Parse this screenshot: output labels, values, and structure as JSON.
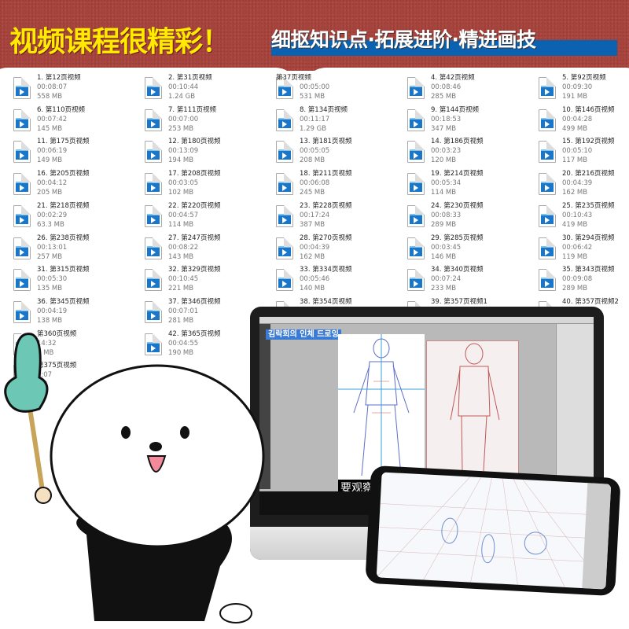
{
  "banner": {
    "title": "视频课程很精彩！",
    "subtitle": "细抠知识点·拓展进阶·精进画技",
    "colors": {
      "background": "#a8433c",
      "title": "#ffea00",
      "subtitle_bar": "#0b62b0"
    }
  },
  "files": [
    {
      "name": "1. 第12页视频",
      "duration": "00:08:07",
      "size": "558 MB"
    },
    {
      "name": "2. 第31页视频",
      "duration": "00:10:44",
      "size": "1.24 GB"
    },
    {
      "name": "第37页视频",
      "duration": "00:05:00",
      "size": "531 MB"
    },
    {
      "name": "4. 第42页视频",
      "duration": "00:08:46",
      "size": "285 MB"
    },
    {
      "name": "5. 第92页视频",
      "duration": "00:09:30",
      "size": "191 MB"
    },
    {
      "name": "6. 第110页视频",
      "duration": "00:07:42",
      "size": "145 MB"
    },
    {
      "name": "7. 第111页视频",
      "duration": "00:07:00",
      "size": "253 MB"
    },
    {
      "name": "8. 第134页视频",
      "duration": "00:11:17",
      "size": "1.29 GB"
    },
    {
      "name": "9. 第144页视频",
      "duration": "00:18:53",
      "size": "347 MB"
    },
    {
      "name": "10. 第146页视频",
      "duration": "00:04:28",
      "size": "499 MB"
    },
    {
      "name": "11. 第175页视频",
      "duration": "00:06:19",
      "size": "149 MB"
    },
    {
      "name": "12. 第180页视频",
      "duration": "00:13:09",
      "size": "194 MB"
    },
    {
      "name": "13. 第181页视频",
      "duration": "00:05:05",
      "size": "208 MB"
    },
    {
      "name": "14. 第186页视频",
      "duration": "00:03:23",
      "size": "120 MB"
    },
    {
      "name": "15. 第192页视频",
      "duration": "00:05:10",
      "size": "117 MB"
    },
    {
      "name": "16. 第205页视频",
      "duration": "00:04:12",
      "size": "205 MB"
    },
    {
      "name": "17. 第208页视频",
      "duration": "00:03:05",
      "size": "102 MB"
    },
    {
      "name": "18. 第211页视频",
      "duration": "00:06:08",
      "size": "245 MB"
    },
    {
      "name": "19. 第214页视频",
      "duration": "00:05:34",
      "size": "114 MB"
    },
    {
      "name": "20. 第216页视频",
      "duration": "00:04:39",
      "size": "162 MB"
    },
    {
      "name": "21. 第218页视频",
      "duration": "00:02:29",
      "size": "63.3 MB"
    },
    {
      "name": "22. 第220页视频",
      "duration": "00:04:57",
      "size": "114 MB"
    },
    {
      "name": "23. 第228页视频",
      "duration": "00:17:24",
      "size": "387 MB"
    },
    {
      "name": "24. 第230页视频",
      "duration": "00:08:33",
      "size": "289 MB"
    },
    {
      "name": "25. 第235页视频",
      "duration": "00:10:43",
      "size": "419 MB"
    },
    {
      "name": "26. 第238页视频",
      "duration": "00:13:01",
      "size": "257 MB"
    },
    {
      "name": "27. 第247页视频",
      "duration": "00:08:22",
      "size": "143 MB"
    },
    {
      "name": "28. 第270页视频",
      "duration": "00:04:39",
      "size": "162 MB"
    },
    {
      "name": "29. 第285页视频",
      "duration": "00:03:45",
      "size": "146 MB"
    },
    {
      "name": "30. 第294页视频",
      "duration": "00:06:42",
      "size": "119 MB"
    },
    {
      "name": "31. 第315页视频",
      "duration": "00:05:30",
      "size": "135 MB"
    },
    {
      "name": "32. 第329页视频",
      "duration": "00:10:45",
      "size": "221 MB"
    },
    {
      "name": "33. 第334页视频",
      "duration": "00:05:46",
      "size": "140 MB"
    },
    {
      "name": "34. 第340页视频",
      "duration": "00:07:24",
      "size": "233 MB"
    },
    {
      "name": "35. 第343页视频",
      "duration": "00:09:08",
      "size": "289 MB"
    },
    {
      "name": "36. 第345页视频",
      "duration": "00:04:19",
      "size": "138 MB"
    },
    {
      "name": "37. 第346页视频",
      "duration": "00:07:01",
      "size": "281 MB"
    },
    {
      "name": "38. 第354页视频",
      "duration": "",
      "size": ""
    },
    {
      "name": "39. 第357页视频1",
      "duration": "",
      "size": ""
    },
    {
      "name": "40. 第357页视频2",
      "duration": "",
      "size": ""
    },
    {
      "name": "第360页视频",
      "duration": "14:32",
      "size": "8 MB"
    },
    {
      "name": "42. 第365页视频",
      "duration": "00:04:55",
      "size": "190 MB"
    },
    null,
    null,
    null,
    {
      "name": "第375页视频",
      "duration": "3:07",
      "size": "MB"
    }
  ],
  "monitor": {
    "overlay_title": "김락희의 인체 드로잉",
    "subtitle_caption": "要观察"
  }
}
